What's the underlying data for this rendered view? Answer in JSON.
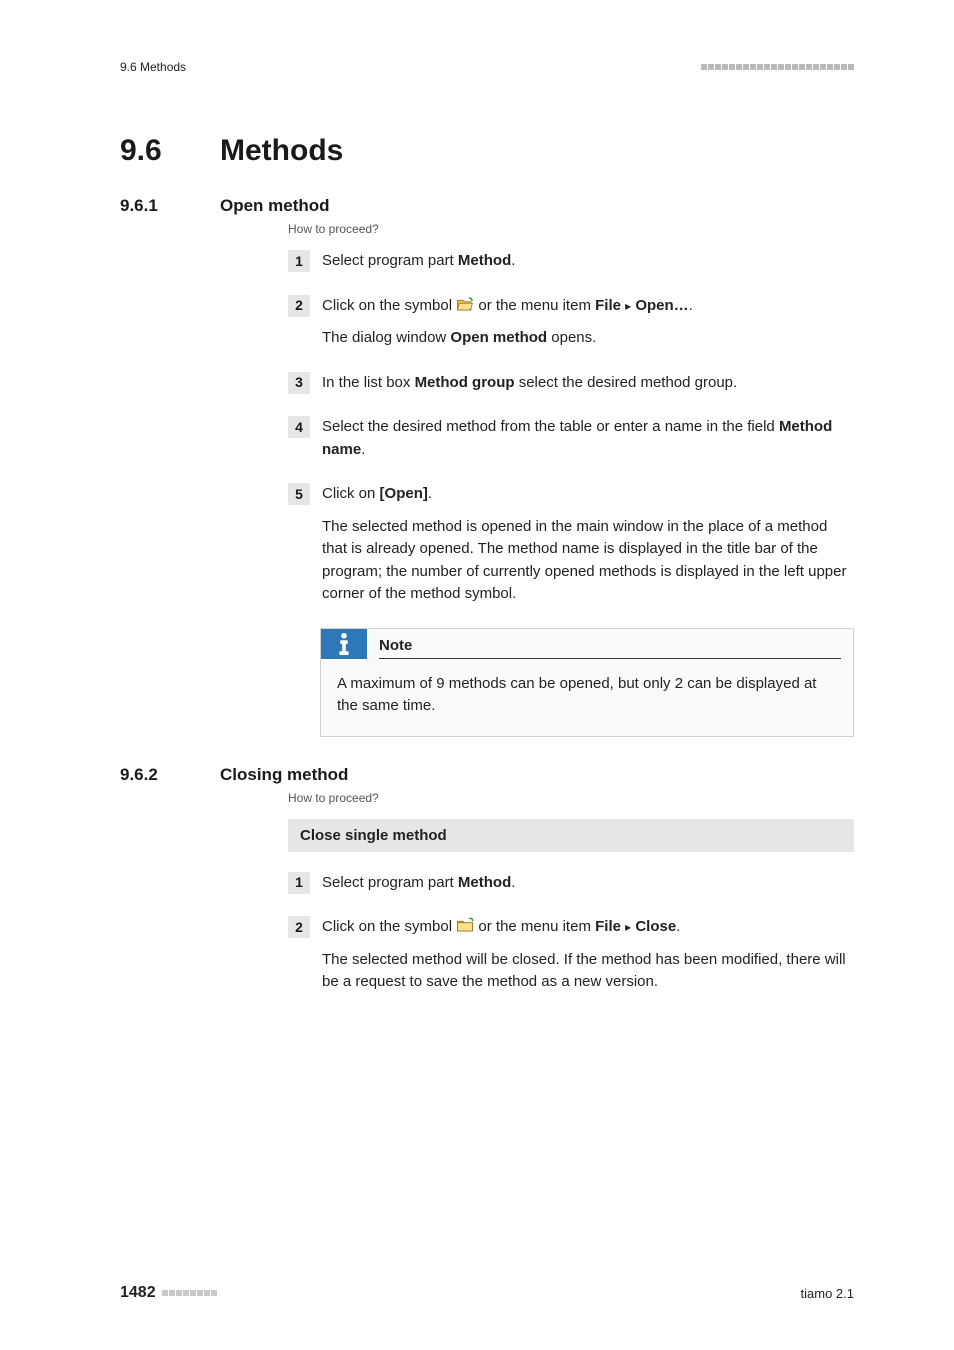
{
  "header": {
    "section_ref": "9.6 Methods"
  },
  "h1": {
    "number": "9.6",
    "title": "Methods"
  },
  "sec1": {
    "number": "9.6.1",
    "title": "Open method",
    "howto": "How to proceed?",
    "steps": {
      "s1": {
        "pre": "Select program part ",
        "bold": "Method",
        "post": "."
      },
      "s2": {
        "l1_pre": "Click on the symbol ",
        "l1_mid": " or the menu item ",
        "l1_file": "File",
        "l1_open": "Open…",
        "l1_post": ".",
        "l2_pre": "The dialog window ",
        "l2_bold": "Open method",
        "l2_post": " opens."
      },
      "s3": {
        "pre": "In the list box ",
        "bold": "Method group",
        "post": " select the desired method group."
      },
      "s4": {
        "pre": "Select the desired method from the table or enter a name in the field ",
        "bold": "Method name",
        "post": "."
      },
      "s5": {
        "l1_pre": "Click on ",
        "l1_bold": "[Open]",
        "l1_post": ".",
        "l2": "The selected method is opened in the main window in the place of a method that is already opened. The method name is displayed in the title bar of the program; the number of currently opened methods is displayed in the left upper corner of the method symbol."
      }
    },
    "note": {
      "title": "Note",
      "body": "A maximum of 9 methods can be opened, but only 2 can be displayed at the same time."
    }
  },
  "sec2": {
    "number": "9.6.2",
    "title": "Closing method",
    "howto": "How to proceed?",
    "bar": "Close single method",
    "steps": {
      "s1": {
        "pre": "Select program part ",
        "bold": "Method",
        "post": "."
      },
      "s2": {
        "l1_pre": "Click on the symbol ",
        "l1_mid": " or the menu item ",
        "l1_file": "File",
        "l1_close": "Close",
        "l1_post": ".",
        "l2": "The selected method will be closed. If the method has been modified, there will be a request to save the method as a new version."
      }
    }
  },
  "footer": {
    "page_number": "1482",
    "product": "tiamo 2.1"
  },
  "step_numbers": {
    "n1": "1",
    "n2": "2",
    "n3": "3",
    "n4": "4",
    "n5": "5"
  }
}
